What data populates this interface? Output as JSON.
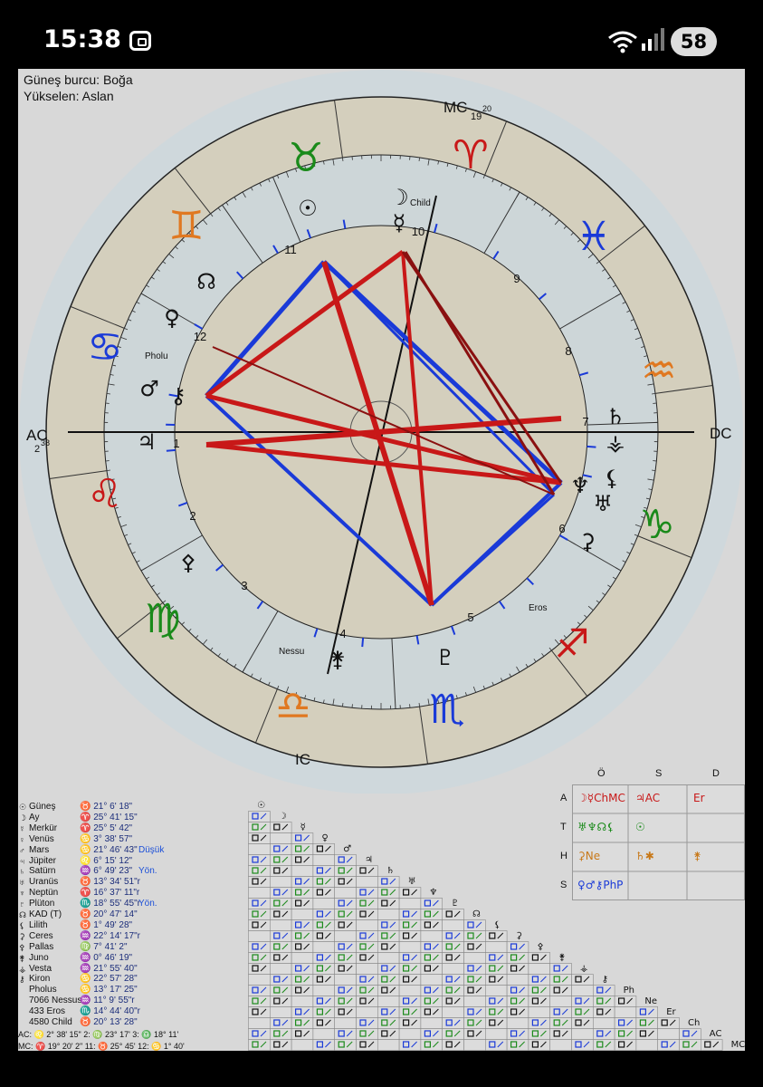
{
  "status_bar": {
    "time": "15:38",
    "battery": "58"
  },
  "header": {
    "sun_sign": "Güneş burcu: Boğa",
    "ascendant": "Yükselen: Aslan"
  },
  "chart_labels": {
    "mc": "MC",
    "mc_deg": "19",
    "mc_min": "20",
    "ac": "AC",
    "ac_deg": "2",
    "ac_min": "38",
    "dc": "DC",
    "ic": "IC",
    "child": "Child",
    "pholu": "Pholu",
    "eros": "Eros",
    "nessu": "Nessu",
    "retro": "r"
  },
  "house_numbers": [
    "1",
    "2",
    "3",
    "4",
    "5",
    "6",
    "7",
    "8",
    "9",
    "10",
    "11",
    "12"
  ],
  "planet_positions": [
    {
      "glyph": "☉",
      "name": "Güneş",
      "value": "♉ 21°  6' 18\"",
      "note": ""
    },
    {
      "glyph": "☽",
      "name": "Ay",
      "value": "♈ 25° 41' 15\"",
      "note": ""
    },
    {
      "glyph": "☿",
      "name": "Merkür",
      "value": "♈ 25°  5' 42\"",
      "note": ""
    },
    {
      "glyph": "♀",
      "name": "Venüs",
      "value": "♋  3° 38' 57\"",
      "note": ""
    },
    {
      "glyph": "♂",
      "name": "Mars",
      "value": "♋ 21° 46' 43\"",
      "note": "Düşük"
    },
    {
      "glyph": "♃",
      "name": "Jüpiter",
      "value": "♌  6° 15' 12\"",
      "note": ""
    },
    {
      "glyph": "♄",
      "name": "Satürn",
      "value": "♒  6° 49' 23\"",
      "note": "Yön."
    },
    {
      "glyph": "♅",
      "name": "Uranüs",
      "value": "♉ 13° 34' 51\"r",
      "note": ""
    },
    {
      "glyph": "♆",
      "name": "Neptün",
      "value": "♈ 16° 37' 11\"r",
      "note": ""
    },
    {
      "glyph": "♇",
      "name": "Plüton",
      "value": "♏ 18° 55' 45\"r",
      "note": "Yön."
    },
    {
      "glyph": "☊",
      "name": "KAD (T)",
      "value": "♉ 20° 47' 14\"",
      "note": ""
    },
    {
      "glyph": "⚸",
      "name": "Lilith",
      "value": "♉  1° 49' 28\"",
      "note": ""
    },
    {
      "glyph": "⚳",
      "name": "Ceres",
      "value": "♒ 22° 14' 17\"r",
      "note": ""
    },
    {
      "glyph": "⚴",
      "name": "Pallas",
      "value": "♍  7° 41'  2\"",
      "note": ""
    },
    {
      "glyph": "⚵",
      "name": "Juno",
      "value": "♒  0° 46' 19\"",
      "note": ""
    },
    {
      "glyph": "⚶",
      "name": "Vesta",
      "value": "♒ 21° 55' 40\"",
      "note": ""
    },
    {
      "glyph": "⚷",
      "name": "Kiron",
      "value": "♋ 22° 57' 28\"",
      "note": ""
    },
    {
      "glyph": "",
      "name": "Pholus",
      "value": "♋ 13° 17' 25\"",
      "note": ""
    },
    {
      "glyph": "",
      "name": "7066 Nessus",
      "value": "♒ 11°  9' 55\"r",
      "note": ""
    },
    {
      "glyph": "",
      "name": "433 Eros",
      "value": "♏ 14° 44' 40\"r",
      "note": ""
    },
    {
      "glyph": "",
      "name": "4580 Child",
      "value": "♉ 20° 13' 28\"",
      "note": ""
    }
  ],
  "house_cusps": [
    {
      "text": "AC: ♌  2° 38' 15\"   2: ♍ 23° 17'   3: ♎ 18° 11'"
    },
    {
      "text": "MC: ♈ 19° 20'  2\"  11: ♉ 25° 45'  12: ♋  1° 40'"
    }
  ],
  "aspect_header_glyphs": [
    "☉",
    "☽",
    "☿",
    "♀",
    "♂",
    "♃",
    "♄",
    "♅",
    "♆",
    "♇",
    "☊",
    "⚸",
    "⚳",
    "⚴",
    "⚵",
    "⚶",
    "⚷",
    "Ph",
    "Ne",
    "Er",
    "Ch",
    "AC",
    "MC"
  ],
  "element_table": {
    "col_headers": [
      "Ö",
      "S",
      "D"
    ],
    "row_headers": [
      "A",
      "T",
      "H",
      "S"
    ],
    "cells": [
      [
        "☽☿ChMC",
        "♃AC",
        "Er"
      ],
      [
        "♅♆☊⚸",
        "☉",
        ""
      ],
      [
        "⚳Ne",
        "♄✱",
        "⚵"
      ],
      [
        "♀♂⚷PhP",
        "",
        ""
      ]
    ],
    "cell_colors": [
      [
        "#c81818",
        "#c81818",
        "#c81818"
      ],
      [
        "#1a8a1a",
        "#1a8a1a",
        "#1a8a1a"
      ],
      [
        "#c87818",
        "#c87818",
        "#c87818"
      ],
      [
        "#1a3ad8",
        "#1a3ad8",
        "#1a3ad8"
      ]
    ]
  },
  "colors": {
    "fire": "#c81818",
    "earth": "#1a8a1a",
    "air": "#e07820",
    "water": "#1a3ad8",
    "trine_sextile": "#1a3ad8",
    "square_opposition": "#c81818"
  }
}
